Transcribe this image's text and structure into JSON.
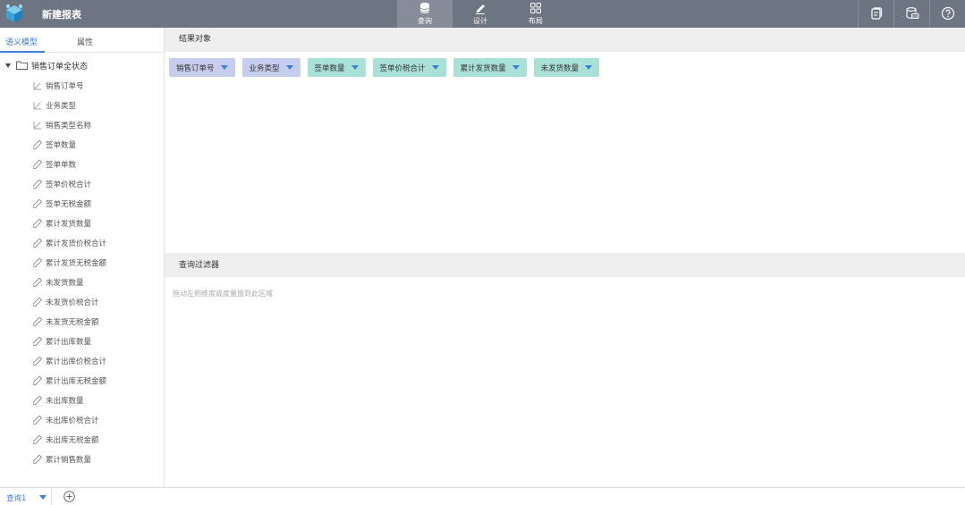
{
  "header": {
    "title": "新建报表",
    "modes": [
      {
        "label": "查询",
        "icon": "database-icon",
        "active": true
      },
      {
        "label": "设计",
        "icon": "pencil-icon",
        "active": false
      },
      {
        "label": "布局",
        "icon": "grid-icon",
        "active": false
      }
    ],
    "tools": [
      "document-icon",
      "sql-icon",
      "help-icon"
    ]
  },
  "sidebar": {
    "tabs": [
      "语义模型",
      "属性"
    ],
    "root": "销售订单全状态",
    "items": [
      {
        "label": "销售订单号",
        "kind": "dimension"
      },
      {
        "label": "业务类型",
        "kind": "dimension"
      },
      {
        "label": "销售类型名称",
        "kind": "dimension"
      },
      {
        "label": "签单数量",
        "kind": "measure"
      },
      {
        "label": "签单单数",
        "kind": "measure"
      },
      {
        "label": "签单价税合计",
        "kind": "measure"
      },
      {
        "label": "签单无税金额",
        "kind": "measure"
      },
      {
        "label": "累计发货数量",
        "kind": "measure"
      },
      {
        "label": "累计发货价税合计",
        "kind": "measure"
      },
      {
        "label": "累计发货无税金额",
        "kind": "measure"
      },
      {
        "label": "未发货数量",
        "kind": "measure"
      },
      {
        "label": "未发货价税合计",
        "kind": "measure"
      },
      {
        "label": "未发货无税金额",
        "kind": "measure"
      },
      {
        "label": "累计出库数量",
        "kind": "measure"
      },
      {
        "label": "累计出库价税合计",
        "kind": "measure"
      },
      {
        "label": "累计出库无税金额",
        "kind": "measure"
      },
      {
        "label": "未出库数量",
        "kind": "measure"
      },
      {
        "label": "未出库价税合计",
        "kind": "measure"
      },
      {
        "label": "未出库无税金额",
        "kind": "measure"
      },
      {
        "label": "累计销售数量",
        "kind": "measure"
      }
    ]
  },
  "results": {
    "title": "结果对象",
    "chips": [
      {
        "label": "销售订单号",
        "kind": "dimension"
      },
      {
        "label": "业务类型",
        "kind": "dimension"
      },
      {
        "label": "签单数量",
        "kind": "measure"
      },
      {
        "label": "签单价税合计",
        "kind": "measure"
      },
      {
        "label": "累计发货数量",
        "kind": "measure"
      },
      {
        "label": "未发货数量",
        "kind": "measure"
      }
    ]
  },
  "filter": {
    "title": "查询过滤器",
    "hint": "拖动左侧维度或度量放到此区域"
  },
  "footer": {
    "query_tab": "查询1"
  },
  "colors": {
    "topbar": "#6d7582",
    "accent": "#3d7fd6",
    "dimension_chip": "#c6cdee",
    "measure_chip": "#a9e0d8"
  }
}
